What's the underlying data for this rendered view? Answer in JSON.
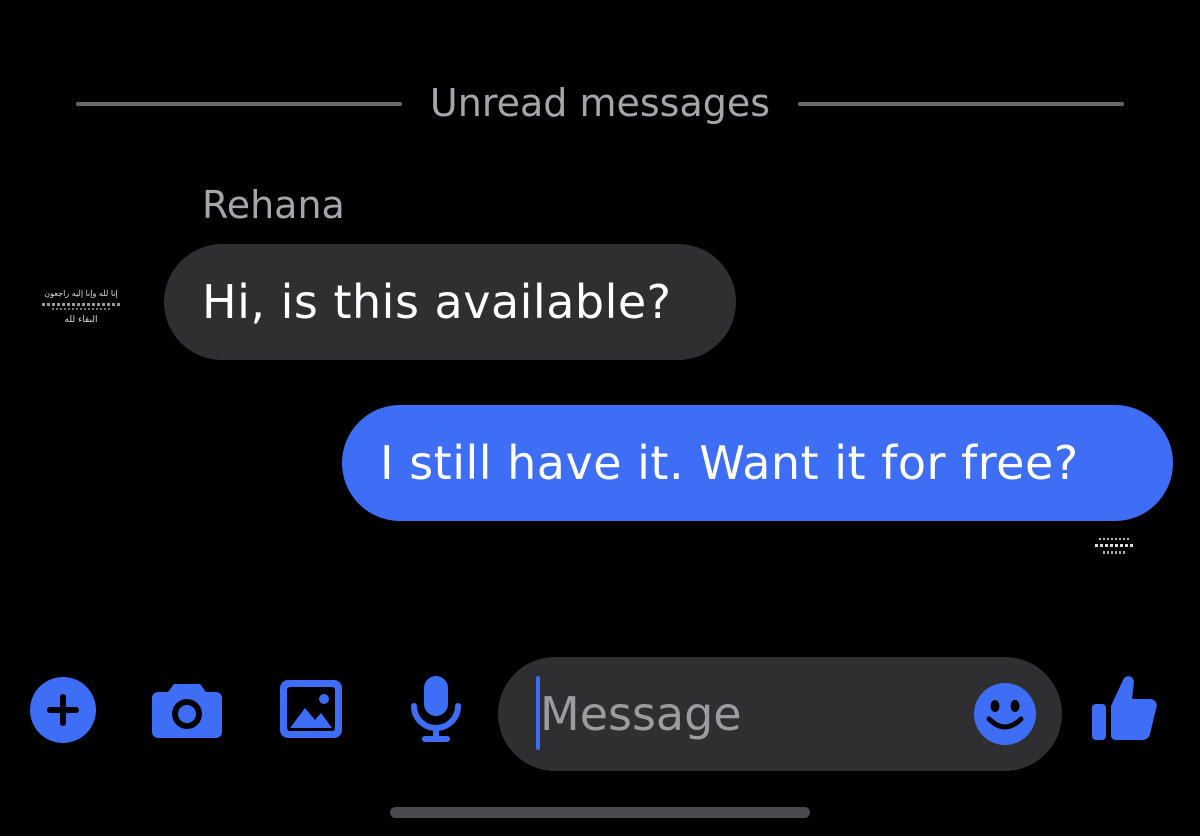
{
  "divider": {
    "label": "Unread messages"
  },
  "thread": {
    "sender_name": "Rehana",
    "avatar_text": {
      "line1": "إنا لله وإنا إليه راجعون",
      "line2": "البقاء لله"
    },
    "messages": [
      {
        "direction": "incoming",
        "text": "Hi, is this available?"
      },
      {
        "direction": "outgoing",
        "text": "I still have it. Want it for free?"
      }
    ]
  },
  "composer": {
    "placeholder": "Message",
    "value": ""
  },
  "toolbar": {
    "icons": [
      "plus-icon",
      "camera-icon",
      "gallery-icon",
      "microphone-icon",
      "emoji-icon",
      "thumbs-up-icon"
    ]
  },
  "colors": {
    "background": "#000000",
    "accent": "#3d6ef5",
    "incoming_bubble": "#2f2f31",
    "outgoing_bubble": "#3d6ef5",
    "secondary_text": "#a6a6aa"
  }
}
